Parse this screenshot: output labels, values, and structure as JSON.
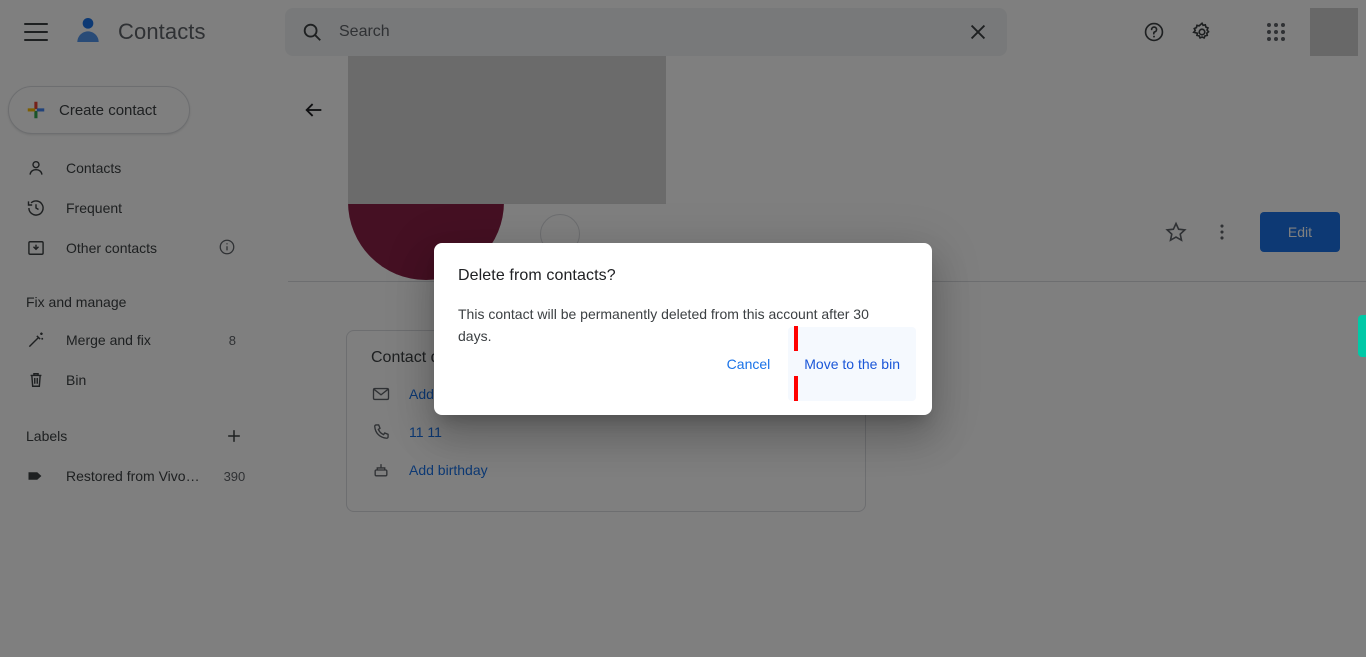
{
  "app": {
    "title": "Contacts",
    "brand_icon": "person-blue-icon",
    "menu_icon": "hamburger-menu-icon"
  },
  "search": {
    "placeholder": "Search",
    "value": "",
    "icon": "search-icon",
    "clear_icon": "close-x-icon"
  },
  "top_right": {
    "help_icon": "help-circle-icon",
    "settings_icon": "gear-icon",
    "apps_icon": "apps-grid-icon",
    "avatar": "account-avatar-placeholder"
  },
  "sidebar": {
    "create_button": {
      "label": "Create contact",
      "icon": "plus-multicolor-icon"
    },
    "items": [
      {
        "label": "Contacts",
        "icon": "person-outline-icon",
        "count": ""
      },
      {
        "label": "Frequent",
        "icon": "history-clock-icon",
        "count": ""
      },
      {
        "label": "Other contacts",
        "icon": "archive-box-icon",
        "count": "",
        "trailing_icon": "info-circle-icon"
      }
    ],
    "fix_section": {
      "title": "Fix and manage",
      "items": [
        {
          "label": "Merge and fix",
          "icon": "magic-wand-icon",
          "count": "8"
        },
        {
          "label": "Bin",
          "icon": "trash-bin-icon",
          "count": ""
        }
      ]
    },
    "labels_section": {
      "title": "Labels",
      "add_icon": "plus-icon",
      "items": [
        {
          "label": "Restored from Vivo…",
          "icon": "label-tag-icon",
          "count": "390"
        }
      ]
    }
  },
  "main": {
    "back_icon": "arrow-left-icon",
    "avatar_color": "#8b2147",
    "actions": {
      "star_icon": "star-outline-icon",
      "more_icon": "more-vert-icon",
      "edit_label": "Edit"
    },
    "detail_card": {
      "title": "Contact details",
      "rows": [
        {
          "icon": "email-envelope-icon",
          "text": "Add email"
        },
        {
          "icon": "phone-icon",
          "text": "11 11"
        },
        {
          "icon": "cake-birthday-icon",
          "text": "Add birthday"
        }
      ]
    }
  },
  "dialog": {
    "title": "Delete from contacts?",
    "body": "This contact will be permanently deleted from this account after 30 days.",
    "cancel_label": "Cancel",
    "confirm_label": "Move to the bin",
    "highlight_color": "#ff0000",
    "accent_color": "#1a73e8"
  }
}
